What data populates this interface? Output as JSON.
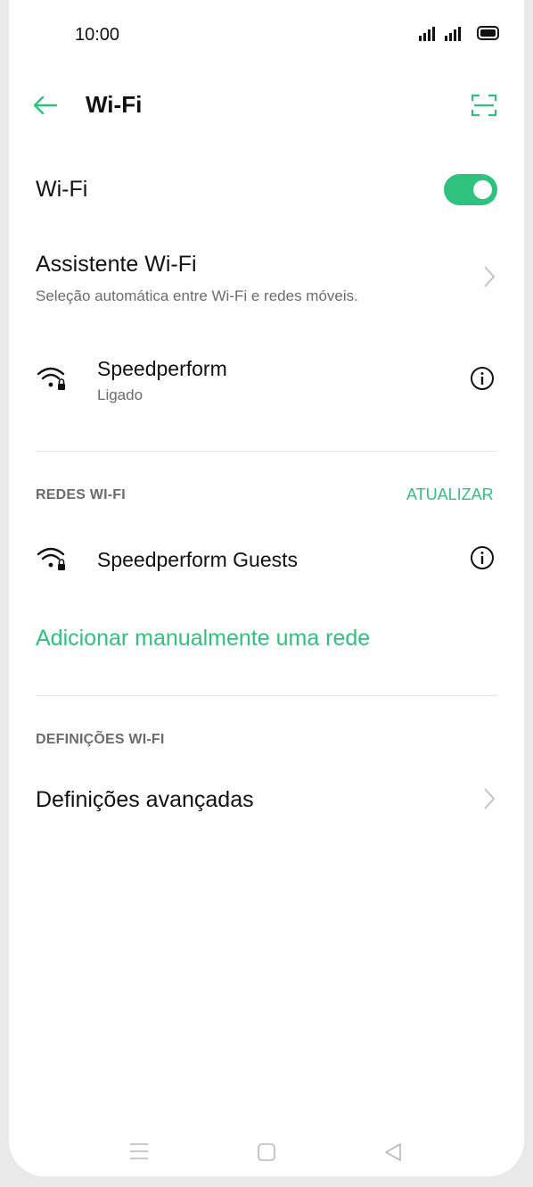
{
  "status_bar": {
    "time": "10:00",
    "icons": [
      "signal-icon",
      "signal-icon",
      "battery-icon"
    ]
  },
  "header": {
    "title": "Wi-Fi",
    "back_icon": "arrow-left-icon",
    "scan_icon": "qr-scan-icon"
  },
  "wifi_toggle": {
    "label": "Wi-Fi",
    "state": "on"
  },
  "assistant": {
    "title": "Assistente Wi-Fi",
    "subtitle": "Seleção automática entre Wi-Fi e redes móveis."
  },
  "connected": {
    "name": "Speedperform",
    "status": "Ligado"
  },
  "networks_section": {
    "title": "REDES WI-FI",
    "refresh": "ATUALIZAR",
    "items": [
      {
        "name": "Speedperform Guests"
      }
    ]
  },
  "add_network": {
    "label": "Adicionar manualmente uma rede"
  },
  "settings_section": {
    "title": "DEFINIÇÕES WI-FI",
    "advanced": "Definições avançadas"
  },
  "nav_bar": {
    "icons": [
      "menu-icon",
      "home-icon",
      "back-triangle-icon"
    ]
  },
  "colors": {
    "accent": "#2ec27e",
    "secondary_text": "#6b6b6b",
    "divider": "#e2e2e2"
  }
}
